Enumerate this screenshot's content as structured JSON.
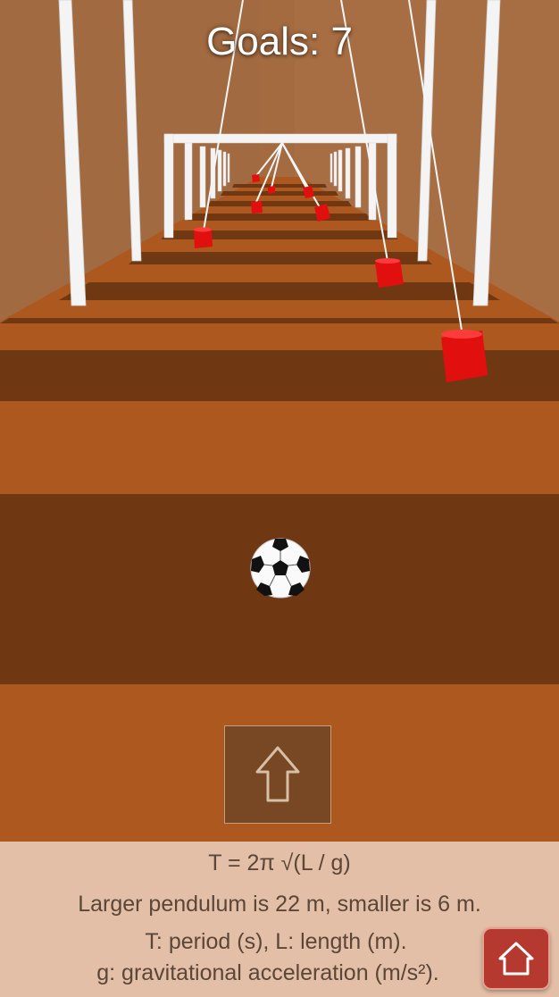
{
  "hud": {
    "score_text": "Goals: 7"
  },
  "controls": {
    "jump_icon": "up-arrow-icon",
    "home_icon": "home-icon"
  },
  "info": {
    "formula": "T = 2π √(L / g)",
    "line1": "Larger pendulum is 22 m, smaller is 6 m.",
    "line2": "T: period (s), L: length (m).",
    "line3": "g: gravitational acceleration (m/s²)."
  },
  "colors": {
    "wall": "#a46b41",
    "floor_light": "#ad581f",
    "floor_dark": "#6f3812",
    "pendulum": "#e20f0f",
    "info_panel": "#e2bfa6",
    "home_button": "#b6392f"
  }
}
